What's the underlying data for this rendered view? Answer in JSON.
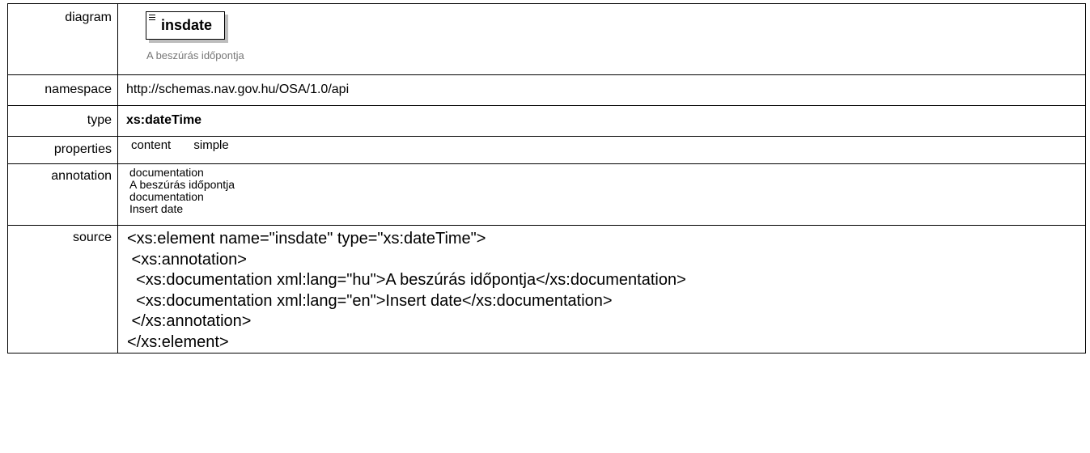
{
  "rows": {
    "diagram": {
      "label": "diagram",
      "element_name": "insdate",
      "element_caption": "A beszúrás időpontja",
      "icon": "element-list-icon"
    },
    "namespace": {
      "label": "namespace",
      "value": "http://schemas.nav.gov.hu/OSA/1.0/api"
    },
    "type": {
      "label": "type",
      "value": "xs:dateTime"
    },
    "properties": {
      "label": "properties",
      "key": "content",
      "value": "simple"
    },
    "annotation": {
      "label": "annotation",
      "lines": [
        "documentation",
        "A beszúrás időpontja",
        "documentation",
        "Insert date"
      ]
    },
    "source": {
      "label": "source",
      "lines": [
        "<xs:element name=\"insdate\" type=\"xs:dateTime\">",
        " <xs:annotation>",
        "  <xs:documentation xml:lang=\"hu\">A beszúrás időpontja</xs:documentation>",
        "  <xs:documentation xml:lang=\"en\">Insert date</xs:documentation>",
        " </xs:annotation>",
        "</xs:element>"
      ]
    }
  }
}
